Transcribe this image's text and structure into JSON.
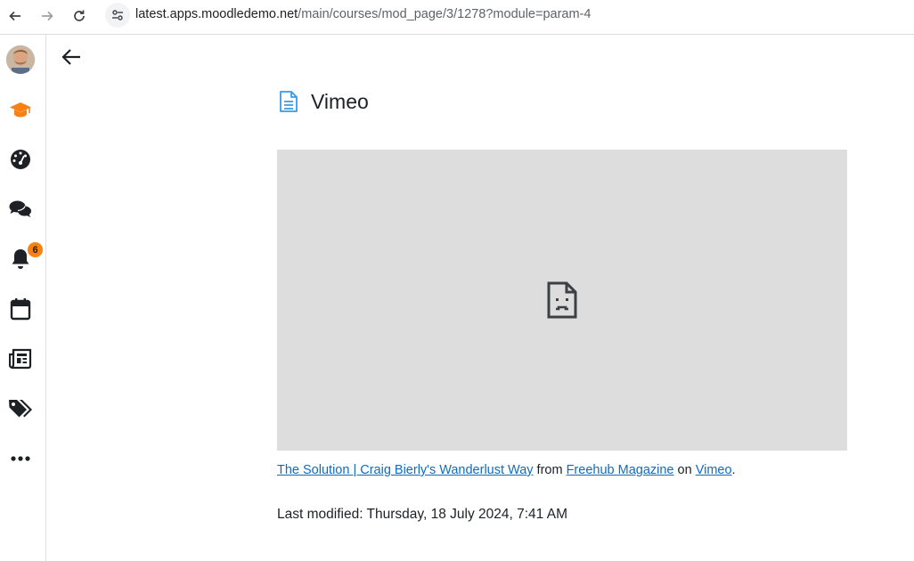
{
  "browser": {
    "url_host": "latest.apps.moodledemo.net",
    "url_path": "/main/courses/mod_page/3/1278?module=param-4"
  },
  "sidebar": {
    "items": [
      {
        "name": "user-avatar",
        "icon": "avatar"
      },
      {
        "name": "my-courses",
        "icon": "graduation-cap-icon",
        "color": "#f98012"
      },
      {
        "name": "dashboard",
        "icon": "gauge-icon"
      },
      {
        "name": "messages",
        "icon": "chat-bubbles-icon"
      },
      {
        "name": "notifications",
        "icon": "bell-icon",
        "badge": "6"
      },
      {
        "name": "calendar",
        "icon": "calendar-icon"
      },
      {
        "name": "site-news",
        "icon": "newspaper-icon"
      },
      {
        "name": "tags",
        "icon": "tags-icon"
      },
      {
        "name": "more",
        "icon": "ellipsis-icon"
      }
    ],
    "notification_count": "6"
  },
  "page": {
    "title": "Vimeo",
    "credit": {
      "video_link": "The Solution | Craig Bierly's Wanderlust Way",
      "from_text": " from ",
      "publisher_link": "Freehub Magazine",
      "on_text": " on ",
      "platform_link": "Vimeo",
      "end_text": "."
    },
    "last_modified": "Last modified: Thursday, 18 July 2024, 7:41 AM"
  },
  "colors": {
    "accent": "#f98012",
    "link": "#0f6cbf",
    "page_icon": "#399be2",
    "video_placeholder_bg": "#dddddd"
  }
}
